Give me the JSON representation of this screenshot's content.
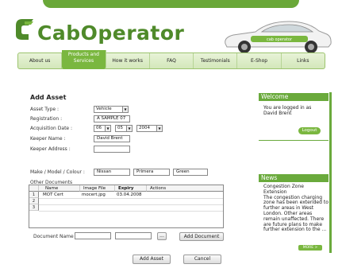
{
  "brand": {
    "name": "CabOperator",
    "accent": "#6aaa3c",
    "dark_green": "#4f8a2a"
  },
  "car": {
    "decal": "cab operator"
  },
  "nav": {
    "items": [
      {
        "label": "About us"
      },
      {
        "label": "Products and Services"
      },
      {
        "label": "How it works"
      },
      {
        "label": "FAQ"
      },
      {
        "label": "Testimonials"
      },
      {
        "label": "E-Shop"
      },
      {
        "label": "Links"
      }
    ]
  },
  "form": {
    "title": "Add Asset",
    "asset_type_label": "Asset Type :",
    "asset_type_value": "Vehicle",
    "registration_label": "Registration :",
    "registration_value": "A SAMPLE 07",
    "acquisition_date_label": "Acquisition Date :",
    "acq_day": "06",
    "acq_month": "05",
    "acq_year": "2004",
    "keeper_name_label": "Keeper Name :",
    "keeper_name_value": "David Brent",
    "keeper_address_label": "Keeper Address :",
    "keeper_address_value": "",
    "make_label": "Make / Model / Colour :",
    "make_value": "Nissan",
    "model_value": "Primera",
    "colour_value": "Green",
    "other_docs_label": "Other Documents",
    "doc_table": {
      "headers": [
        "Name",
        "Image File",
        "Expiry",
        "Actions"
      ],
      "rows": [
        {
          "num": "1",
          "name": "MOT Cert",
          "file": "mocert.jpg",
          "expiry": "03.04.2008",
          "actions": ""
        },
        {
          "num": "2",
          "name": "",
          "file": "",
          "expiry": "",
          "actions": ""
        },
        {
          "num": "3",
          "name": "",
          "file": "",
          "expiry": "",
          "actions": ""
        }
      ]
    },
    "document_name_label": "Document Name",
    "browse_label": "...",
    "add_document_label": "Add Document",
    "add_asset_label": "Add Asset",
    "cancel_label": "Cancel"
  },
  "sidebar": {
    "welcome_title": "Welcome",
    "logged_in_line1": "You are logged in as",
    "logged_in_user": "David Brent",
    "logout_label": "Logout",
    "news_title": "News",
    "news_headline": "Congestion Zone Extension",
    "news_body": "The congestion charging zone has been extended to further areas in West London. Other areas remain unaffected. There are future plans to make further extension to the ...",
    "more_label": "MORE >"
  }
}
